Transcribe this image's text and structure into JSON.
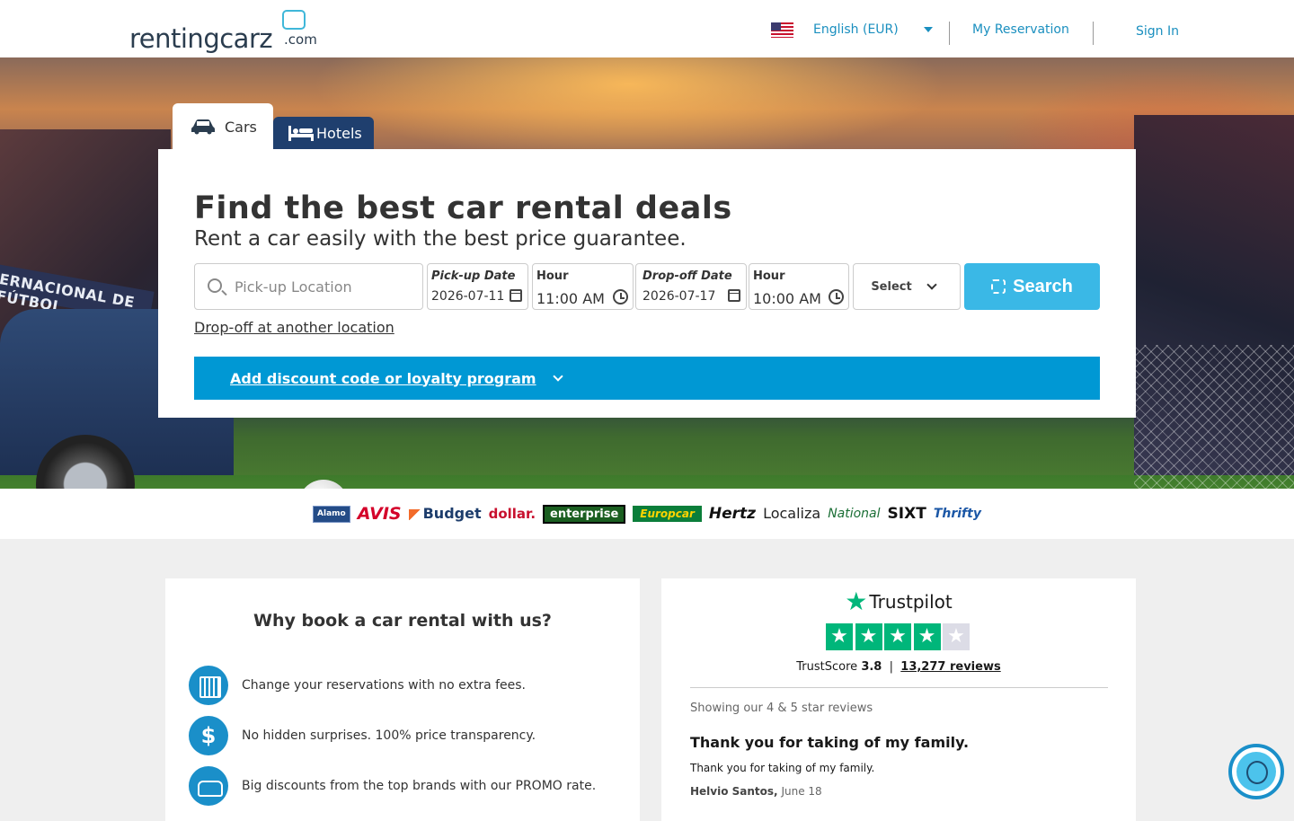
{
  "header": {
    "logo": "rentingcarz.com",
    "logo_main": "rentingcarz",
    "logo_tld": ".com",
    "language": "English (EUR)",
    "my_reservation": "My Reservation",
    "sign_in": "Sign In"
  },
  "tabs": [
    {
      "label": "Cars",
      "active": true,
      "icon": "car-icon"
    },
    {
      "label": "Hotels",
      "active": false,
      "icon": "bed-icon"
    }
  ],
  "hero_banner_text": "ERNACIONAL DE FÚTBOL",
  "search": {
    "title": "Find the best car rental deals",
    "subtitle": "Rent a car easily with the best price guarantee.",
    "location_placeholder": "Pick-up Location",
    "pickup_date_label": "Pick-up Date",
    "pickup_date": "2026-07-11",
    "pickup_hour_label": "Hour",
    "pickup_hour": "11:00 AM",
    "dropoff_date_label": "Drop-off Date",
    "dropoff_date": "2026-07-17",
    "dropoff_hour_label": "Hour",
    "dropoff_hour": "10:00 AM",
    "select_label": "Select",
    "search_button": "Search",
    "dropoff_link": "Drop-off at another location",
    "discount_label": "Add discount code or loyalty program"
  },
  "brands": [
    "Alamo",
    "AVIS",
    "Budget",
    "dollar.",
    "enterprise",
    "Europcar",
    "Hertz",
    "Localiza",
    "National",
    "SIXT",
    "Thrifty"
  ],
  "why": {
    "title": "Why book a car rental with us?",
    "items": [
      {
        "icon": "calendar-icon",
        "text": "Change your reservations with no extra fees."
      },
      {
        "icon": "dollar-icon",
        "text": "No hidden surprises. 100% price transparency."
      },
      {
        "icon": "car-icon",
        "text": "Big discounts from the top brands with our PROMO rate."
      }
    ]
  },
  "trustpilot": {
    "brand": "Trustpilot",
    "stars_filled": 4,
    "stars_total": 5,
    "score_label": "TrustScore",
    "score": "3.8",
    "reviews_count": "13,277",
    "reviews_word": "reviews",
    "showing": "Showing our 4 & 5 star reviews",
    "review": {
      "title": "Thank you for taking of my family.",
      "body": "Thank you for taking of my family.",
      "author": "Helvio Santos,",
      "date": "June 18"
    }
  },
  "colors": {
    "accent": "#1a8fbf",
    "search_button": "#3ab8e6",
    "discount_bar": "#0098d4",
    "trustpilot_green": "#00b67a",
    "hotels_tab": "#1f3f6e"
  }
}
